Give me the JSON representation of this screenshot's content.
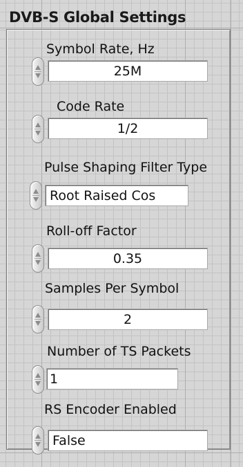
{
  "panel": {
    "title": "DVB-S Global Settings"
  },
  "controls": [
    {
      "id": "symbol-rate",
      "label": "Symbol Rate, Hz",
      "value": "25M",
      "align": "center"
    },
    {
      "id": "code-rate",
      "label": "Code Rate",
      "value": "1/2",
      "align": "center"
    },
    {
      "id": "pulse-shaping-filter-type",
      "label": "Pulse Shaping Filter Type",
      "value": "Root Raised Cos",
      "align": "left"
    },
    {
      "id": "roll-off-factor",
      "label": "Roll-off Factor",
      "value": "0.35",
      "align": "center"
    },
    {
      "id": "samples-per-symbol",
      "label": "Samples Per Symbol",
      "value": "2",
      "align": "center"
    },
    {
      "id": "number-of-ts-packets",
      "label": "Number of TS Packets",
      "value": "1",
      "align": "left"
    },
    {
      "id": "rs-encoder-enabled",
      "label": "RS Encoder Enabled",
      "value": "False",
      "align": "left"
    }
  ],
  "icons": {
    "increment": "spin-up-arrow-icon",
    "decrement": "spin-down-arrow-icon"
  },
  "colors": {
    "panel_background": "#d6d6d6",
    "grid_line": "#c3c3c3",
    "field_background": "#ffffff",
    "text": "#111111"
  }
}
